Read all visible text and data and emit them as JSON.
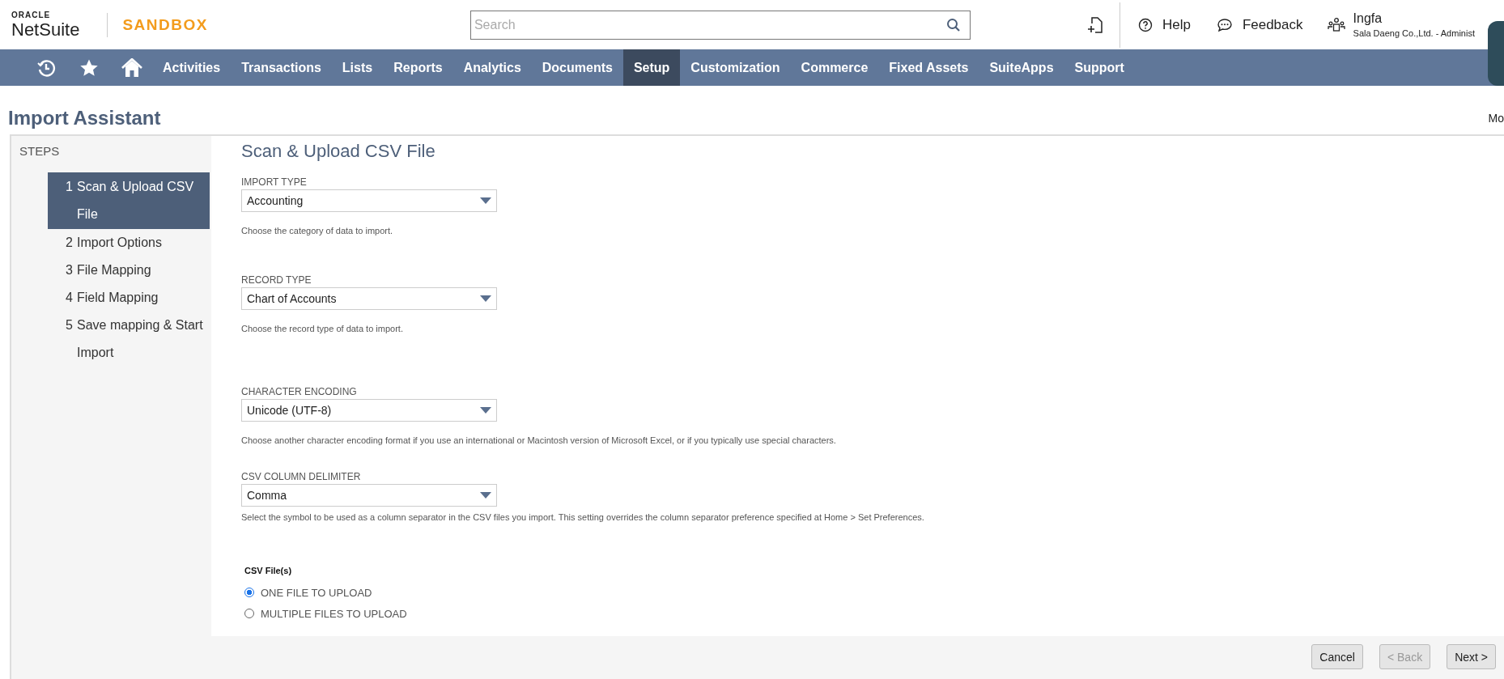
{
  "header": {
    "logo_top": "ORACLE",
    "logo_bottom": "NetSuite",
    "environment": "SANDBOX",
    "search": {
      "placeholder": "Search"
    },
    "help": "Help",
    "feedback": "Feedback",
    "user": {
      "name": "Ingfa",
      "role": "Sala Daeng Co.,Ltd. - Administ"
    }
  },
  "nav": {
    "icons": [
      {
        "kind": "recent"
      },
      {
        "kind": "star"
      },
      {
        "kind": "home"
      }
    ],
    "items": [
      {
        "label": "Activities",
        "selected": false
      },
      {
        "label": "Transactions",
        "selected": false
      },
      {
        "label": "Lists",
        "selected": false
      },
      {
        "label": "Reports",
        "selected": false
      },
      {
        "label": "Analytics",
        "selected": false
      },
      {
        "label": "Documents",
        "selected": false
      },
      {
        "label": "Setup",
        "selected": true
      },
      {
        "label": "Customization",
        "selected": false
      },
      {
        "label": "Commerce",
        "selected": false
      },
      {
        "label": "Fixed Assets",
        "selected": false
      },
      {
        "label": "SuiteApps",
        "selected": false
      },
      {
        "label": "Support",
        "selected": false
      }
    ]
  },
  "page": {
    "title": "Import Assistant",
    "right_text": "Mo"
  },
  "steps": {
    "heading": "STEPS",
    "items": [
      {
        "number": "1",
        "label": "Scan & Upload CSV File",
        "selected": true
      },
      {
        "number": "2",
        "label": "Import Options",
        "selected": false
      },
      {
        "number": "3",
        "label": "File Mapping",
        "selected": false
      },
      {
        "number": "4",
        "label": "Field Mapping",
        "selected": false
      },
      {
        "number": "5",
        "label": "Save mapping & Start Import",
        "selected": false
      }
    ]
  },
  "form": {
    "heading": "Scan & Upload CSV File",
    "fields": [
      {
        "label": "IMPORT TYPE",
        "value": "Accounting",
        "help": "Choose the category of data to import."
      },
      {
        "label": "RECORD TYPE",
        "value": "Chart of Accounts",
        "help": "Choose the record type of data to import."
      },
      {
        "label": "CHARACTER ENCODING",
        "value": "Unicode (UTF-8)",
        "help": "Choose another character encoding format if you use an international or Macintosh version of Microsoft Excel, or if you typically use special characters."
      },
      {
        "label": "CSV COLUMN DELIMITER",
        "value": "Comma",
        "help": "Select the symbol to be used as a column separator in the CSV files you import. This setting overrides the column separator preference specified at Home > Set Preferences."
      }
    ],
    "files": {
      "label": "CSV File(s)",
      "options": [
        {
          "label": "ONE FILE TO UPLOAD",
          "selected": true
        },
        {
          "label": "MULTIPLE FILES TO UPLOAD",
          "selected": false
        }
      ]
    }
  },
  "buttons": [
    {
      "label": "Cancel",
      "disabled": false
    },
    {
      "label": "< Back",
      "disabled": true
    },
    {
      "label": "Next >",
      "disabled": false
    }
  ]
}
